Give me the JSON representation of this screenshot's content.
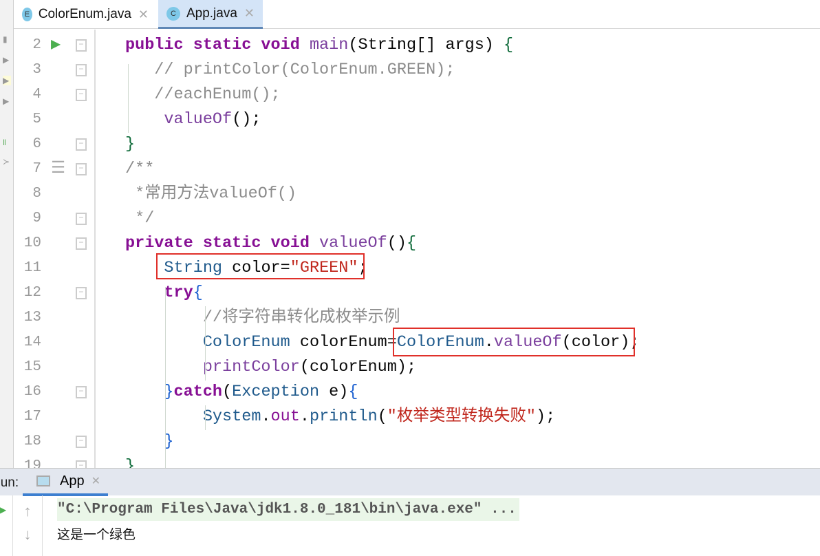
{
  "tabs": [
    {
      "label": "ColorEnum.java",
      "icon": "E",
      "active": false
    },
    {
      "label": "App.java",
      "icon": "C",
      "active": true
    }
  ],
  "code": [
    {
      "n": "2",
      "run": true,
      "fold": true,
      "t": [
        [
          "kw",
          "public static void "
        ],
        [
          "fn",
          "main"
        ],
        [
          "pl",
          "(String[] args) "
        ],
        [
          "br",
          "{"
        ]
      ]
    },
    {
      "n": "3",
      "fold": true,
      "t": [
        [
          "cm",
          "   // printColor(ColorEnum.GREEN);"
        ]
      ]
    },
    {
      "n": "4",
      "fold": true,
      "t": [
        [
          "cm",
          "   //eachEnum();"
        ]
      ]
    },
    {
      "n": "5",
      "t": [
        [
          "fn",
          "    valueOf"
        ],
        [
          "pl",
          "();"
        ]
      ]
    },
    {
      "n": "6",
      "fold": true,
      "t": [
        [
          "br",
          "}"
        ]
      ]
    },
    {
      "n": "7",
      "doc": true,
      "fold": true,
      "t": [
        [
          "cm",
          "/**"
        ]
      ]
    },
    {
      "n": "8",
      "t": [
        [
          "cm",
          " *常用方法valueOf()"
        ]
      ]
    },
    {
      "n": "9",
      "fold": true,
      "t": [
        [
          "cm",
          " */"
        ]
      ]
    },
    {
      "n": "10",
      "fold": true,
      "t": [
        [
          "kw",
          "private static void "
        ],
        [
          "fn",
          "valueOf"
        ],
        [
          "pl",
          "()"
        ],
        [
          "br",
          "{"
        ]
      ]
    },
    {
      "n": "11",
      "t": [
        [
          "cls",
          "    String "
        ],
        [
          "pl",
          "color="
        ],
        [
          "str",
          "\"GREEN\""
        ],
        [
          "pl",
          ";"
        ]
      ]
    },
    {
      "n": "12",
      "fold": true,
      "t": [
        [
          "kw",
          "    try"
        ],
        [
          "br2",
          "{"
        ]
      ]
    },
    {
      "n": "13",
      "t": [
        [
          "cm",
          "        //将字符串转化成枚举示例"
        ]
      ]
    },
    {
      "n": "14",
      "t": [
        [
          "cls",
          "        ColorEnum "
        ],
        [
          "pl",
          "colorEnum="
        ],
        [
          "cls",
          "ColorEnum"
        ],
        [
          "pl",
          "."
        ],
        [
          "fn",
          "valueOf"
        ],
        [
          "pl",
          "(color);"
        ]
      ]
    },
    {
      "n": "15",
      "t": [
        [
          "fn",
          "        printColor"
        ],
        [
          "pl",
          "(colorEnum);"
        ]
      ]
    },
    {
      "n": "16",
      "fold": true,
      "t": [
        [
          "br2",
          "    }"
        ],
        [
          "kw",
          "catch"
        ],
        [
          "pl",
          "("
        ],
        [
          "cls",
          "Exception "
        ],
        [
          "pl",
          "e)"
        ],
        [
          "br2",
          "{"
        ]
      ]
    },
    {
      "n": "17",
      "t": [
        [
          "cls",
          "        System"
        ],
        [
          "pl",
          "."
        ],
        [
          "fld",
          "out"
        ],
        [
          "pl",
          "."
        ],
        [
          "cls",
          "println"
        ],
        [
          "pl",
          "("
        ],
        [
          "str",
          "\"枚举类型转换失败\""
        ],
        [
          "pl",
          ");"
        ]
      ]
    },
    {
      "n": "18",
      "fold": true,
      "t": [
        [
          "br2",
          "    }"
        ]
      ]
    },
    {
      "n": "19",
      "fold": true,
      "t": [
        [
          "br",
          "}"
        ]
      ]
    }
  ],
  "run": {
    "label": "Run:",
    "tab": "App",
    "command": "\"C:\\Program Files\\Java\\jdk1.8.0_181\\bin\\java.exe\" ...",
    "output": "这是一个绿色"
  }
}
